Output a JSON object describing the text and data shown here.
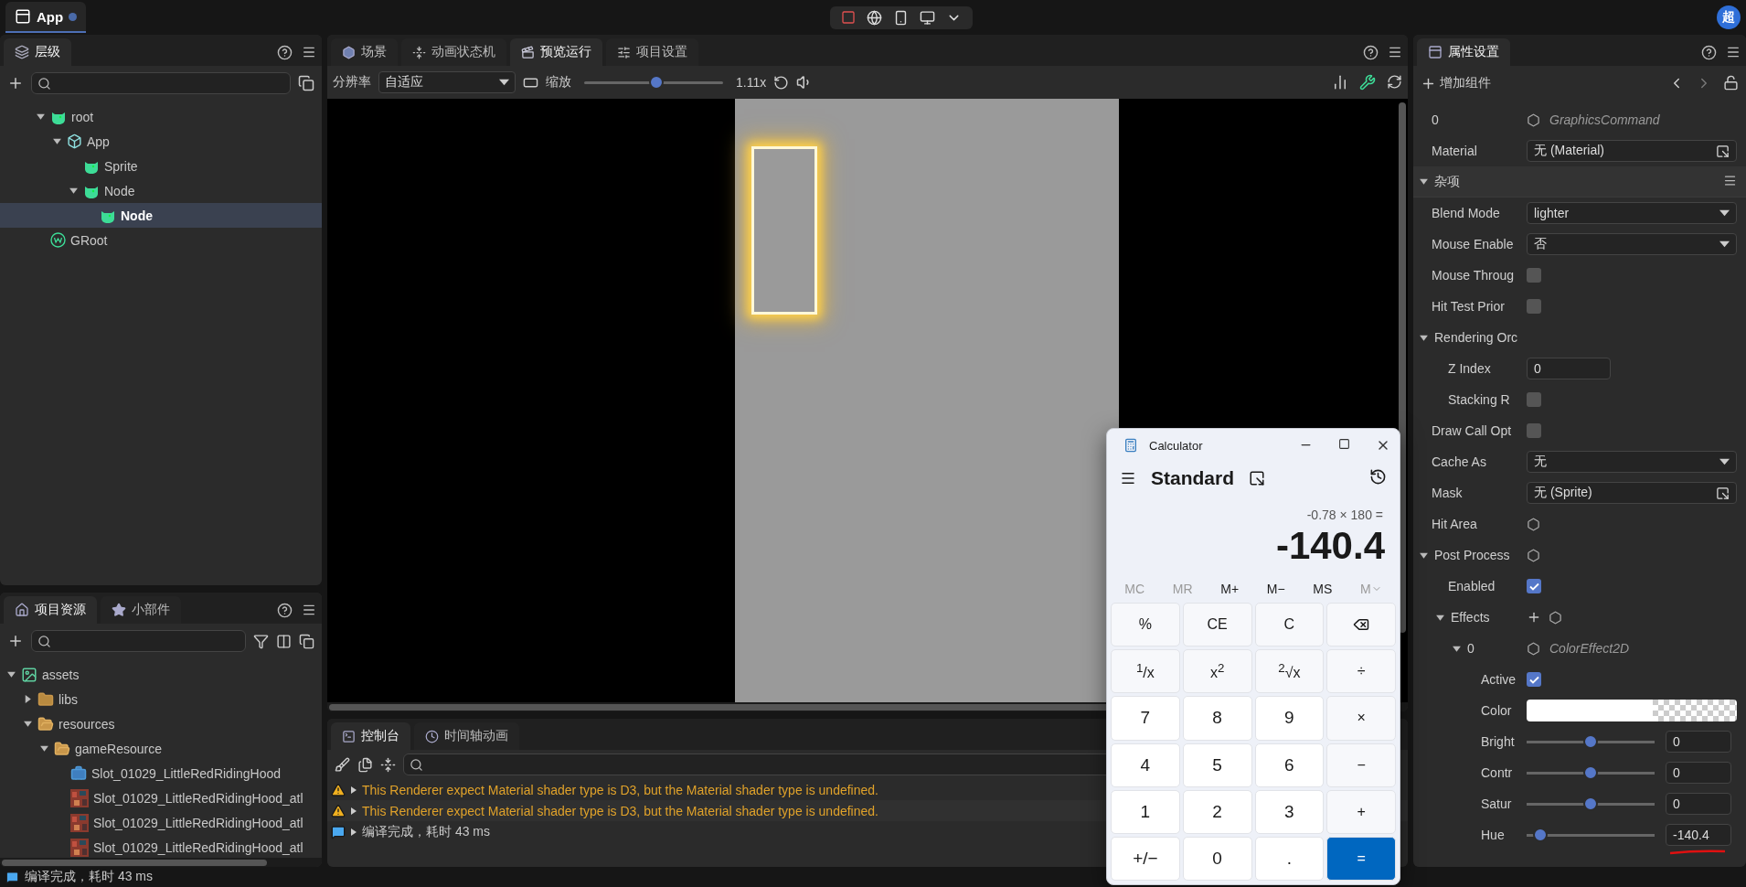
{
  "top_bar": {
    "app_tab": {
      "label": "App",
      "unsaved": true
    },
    "avatar": "超"
  },
  "hierarchy": {
    "title": "层级",
    "items": [
      {
        "label": "root",
        "kind": "node",
        "expanded": true,
        "selected": false,
        "children": [
          {
            "label": "App",
            "kind": "scene",
            "expanded": true,
            "selected": false,
            "children": [
              {
                "label": "Sprite",
                "kind": "node",
                "selected": false
              },
              {
                "label": "Node",
                "kind": "node",
                "expanded": true,
                "selected": false,
                "children": [
                  {
                    "label": "Node",
                    "kind": "node",
                    "selected": true
                  }
                ]
              }
            ]
          }
        ]
      },
      {
        "label": "GRoot",
        "kind": "groot",
        "selected": false
      }
    ]
  },
  "resources": {
    "tabs": [
      {
        "label": "项目资源",
        "selected": true
      },
      {
        "label": "小部件",
        "selected": false
      }
    ],
    "items": [
      {
        "label": "assets",
        "kind": "assets",
        "expanded": true,
        "children": [
          {
            "label": "libs",
            "kind": "folder",
            "expanded": false
          },
          {
            "label": "resources",
            "kind": "folder",
            "expanded": true,
            "children": [
              {
                "label": "gameResource",
                "kind": "folder",
                "expanded": true,
                "children": [
                  {
                    "label": "Slot_01029_LittleRedRidingHood",
                    "kind": "prefab"
                  },
                  {
                    "label": "Slot_01029_LittleRedRidingHood_atl",
                    "kind": "atlas"
                  },
                  {
                    "label": "Slot_01029_LittleRedRidingHood_atl",
                    "kind": "atlas"
                  },
                  {
                    "label": "Slot_01029_LittleRedRidingHood_atl",
                    "kind": "atlas"
                  }
                ]
              }
            ]
          }
        ]
      }
    ]
  },
  "status_bar": "编译完成，耗时 43 ms",
  "editor_tabs": [
    {
      "label": "场景",
      "selected": false
    },
    {
      "label": "动画状态机",
      "selected": false
    },
    {
      "label": "预览运行",
      "selected": true
    },
    {
      "label": "项目设置",
      "selected": false
    }
  ],
  "preview_toolbar": {
    "resolution_label": "分辨率",
    "resolution": "自适应",
    "zoom_label": "缩放",
    "zoom": {
      "level": 0.52
    },
    "zoom_reading": "1.11x"
  },
  "console": {
    "tabs": [
      {
        "label": "控制台",
        "selected": true
      },
      {
        "label": "时间轴动画",
        "selected": false
      }
    ],
    "entries": [
      {
        "kind": "warning",
        "text": "This Renderer expect Material shader type is D3, but the Material shader type is undefined."
      },
      {
        "kind": "warning",
        "text": "This Renderer expect Material shader type is D3, but the Material shader type is undefined."
      },
      {
        "kind": "info",
        "text": "编译完成，耗时 43 ms"
      }
    ]
  },
  "inspector": {
    "title": "属性设置",
    "add_component": "增加组件",
    "rows": [
      {
        "kind": "ref",
        "label": "0",
        "value": "GraphicsCommand"
      },
      {
        "kind": "asset",
        "label": "Material",
        "value": "无 (Material)"
      },
      {
        "kind": "section",
        "label": "杂项",
        "expanded": true
      },
      {
        "kind": "dropdown",
        "label": "Blend Mode",
        "value": "lighter"
      },
      {
        "kind": "dropdown",
        "label": "Mouse Enable",
        "value": "否"
      },
      {
        "kind": "checkbox",
        "label": "Mouse Throug",
        "checked": false
      },
      {
        "kind": "checkbox",
        "label": "Hit Test Prior",
        "checked": false
      },
      {
        "kind": "group",
        "label": "Rendering Orc",
        "expanded": true,
        "children": [
          {
            "kind": "input",
            "label": "Z Index",
            "value": "0"
          },
          {
            "kind": "checkbox",
            "label": "Stacking R",
            "checked": false
          }
        ]
      },
      {
        "kind": "checkbox",
        "label": "Draw Call Opt",
        "checked": false
      },
      {
        "kind": "dropdown",
        "label": "Cache As",
        "value": "无"
      },
      {
        "kind": "asset",
        "label": "Mask",
        "value": "无 (Sprite)"
      },
      {
        "kind": "gear",
        "label": "Hit Area"
      },
      {
        "kind": "group",
        "label": "Post Process",
        "expanded": true,
        "gear": true,
        "children": [
          {
            "kind": "checkbox",
            "label": "Enabled",
            "checked": true
          },
          {
            "kind": "group",
            "label": "Effects",
            "expanded": true,
            "add": true,
            "gear": true,
            "children": [
              {
                "kind": "ref",
                "label": "0",
                "value": "ColorEffect2D",
                "expanded": true,
                "children": [
                  {
                    "kind": "checkbox",
                    "label": "Active",
                    "checked": true
                  },
                  {
                    "kind": "color",
                    "label": "Color"
                  },
                  {
                    "kind": "slider",
                    "label": "Bright",
                    "level": 0.5,
                    "value": "0"
                  },
                  {
                    "kind": "slider",
                    "label": "Contr",
                    "level": 0.5,
                    "value": "0"
                  },
                  {
                    "kind": "slider",
                    "label": "Satur",
                    "level": 0.5,
                    "value": "0"
                  },
                  {
                    "kind": "slider",
                    "label": "Hue",
                    "level": 0.11,
                    "value": "-140.4",
                    "underlined": true
                  }
                ]
              }
            ]
          }
        ]
      }
    ]
  },
  "calculator": {
    "title": "Calculator",
    "mode": "Standard",
    "expression": "-0.78 × 180 =",
    "display": "-140.4",
    "memory": [
      {
        "label": "MC",
        "disabled": true
      },
      {
        "label": "MR",
        "disabled": true
      },
      {
        "label": "M+",
        "disabled": false
      },
      {
        "label": "M−",
        "disabled": false
      },
      {
        "label": "MS",
        "disabled": false
      },
      {
        "label": "M",
        "disabled": true
      }
    ],
    "keys": [
      {
        "kind": "function",
        "label": "%"
      },
      {
        "kind": "function",
        "label": "CE"
      },
      {
        "kind": "function",
        "label": "C"
      },
      {
        "kind": "backspace"
      },
      {
        "kind": "function",
        "label": "$^{1}$/x"
      },
      {
        "kind": "function",
        "label": "x$^{2}$"
      },
      {
        "kind": "function",
        "label": "$^{2}$√x"
      },
      {
        "kind": "function",
        "label": "÷"
      },
      {
        "kind": "digit",
        "label": "7"
      },
      {
        "kind": "digit",
        "label": "8"
      },
      {
        "kind": "digit",
        "label": "9"
      },
      {
        "kind": "function",
        "label": "×"
      },
      {
        "kind": "digit",
        "label": "4"
      },
      {
        "kind": "digit",
        "label": "5"
      },
      {
        "kind": "digit",
        "label": "6"
      },
      {
        "kind": "function",
        "label": "−"
      },
      {
        "kind": "digit",
        "label": "1"
      },
      {
        "kind": "digit",
        "label": "2"
      },
      {
        "kind": "digit",
        "label": "3"
      },
      {
        "kind": "function",
        "label": "+"
      },
      {
        "kind": "digit",
        "label": "+/−"
      },
      {
        "kind": "digit",
        "label": "0"
      },
      {
        "kind": "digit",
        "label": "."
      },
      {
        "kind": "equals",
        "label": "="
      }
    ]
  }
}
